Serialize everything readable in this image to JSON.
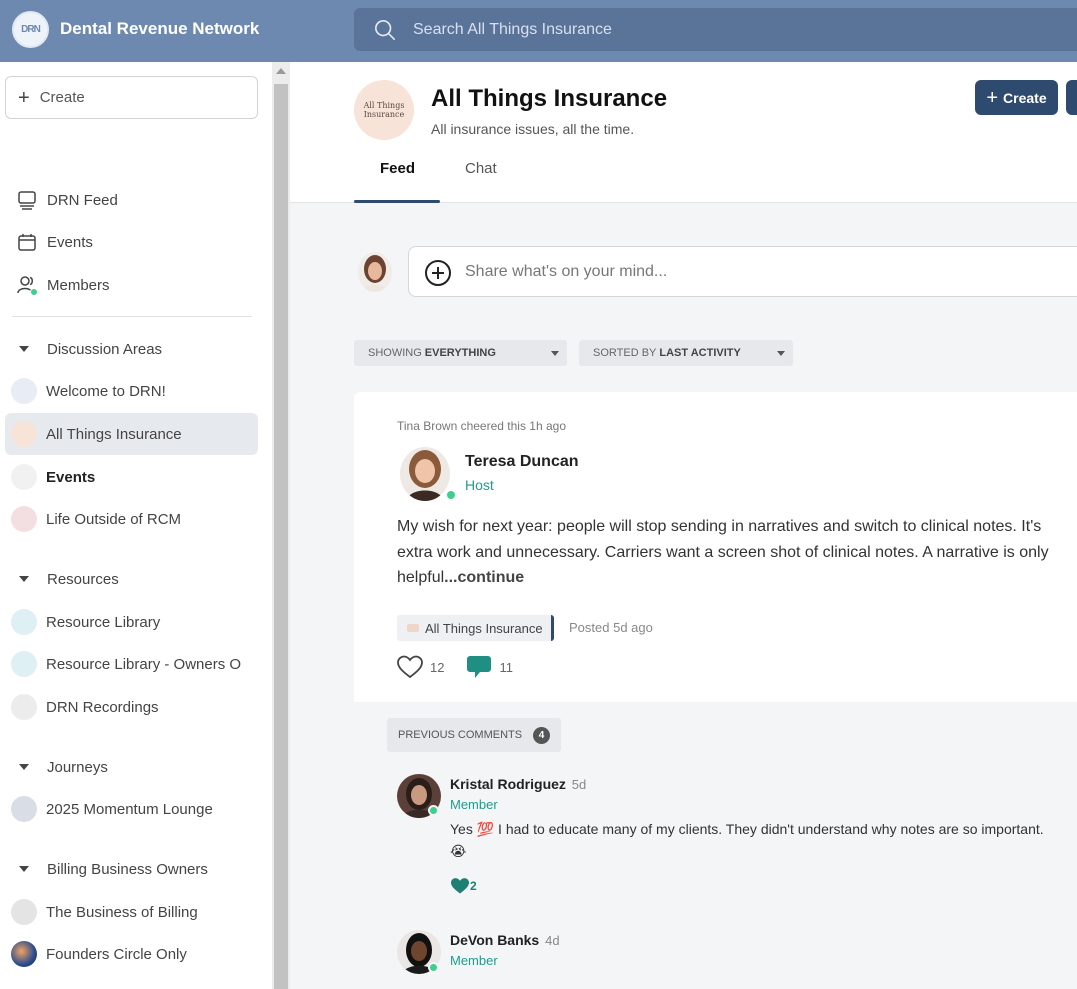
{
  "app": {
    "name": "Dental Revenue Network",
    "logo_text": "DRN"
  },
  "search": {
    "placeholder": "Search All Things Insurance"
  },
  "sidebar": {
    "create_label": "Create",
    "top_items": [
      {
        "label": "DRN Feed",
        "icon": "monitor-icon"
      },
      {
        "label": "Events",
        "icon": "calendar-icon"
      },
      {
        "label": "Members",
        "icon": "people-icon"
      }
    ],
    "sections": [
      {
        "label": "Discussion Areas",
        "items": [
          "Welcome to DRN!",
          "All Things Insurance",
          "Events",
          "Life Outside of RCM"
        ]
      },
      {
        "label": "Resources",
        "items": [
          "Resource Library",
          "Resource Library - Owners O",
          "DRN Recordings"
        ]
      },
      {
        "label": "Journeys",
        "items": [
          "2025 Momentum Lounge"
        ]
      },
      {
        "label": "Billing Business Owners",
        "items": [
          "The Business of Billing",
          "Founders Circle Only"
        ]
      }
    ],
    "active_item": "All Things Insurance"
  },
  "group": {
    "avatar_text": "All Things Insurance",
    "title": "All Things Insurance",
    "subtitle": "All insurance issues, all the time.",
    "create_label": "Create",
    "tabs": [
      "Feed",
      "Chat"
    ],
    "active_tab": "Feed"
  },
  "composer": {
    "placeholder": "Share what's on your mind..."
  },
  "filters": {
    "showing_prefix": "SHOWING",
    "showing_value": "EVERYTHING",
    "sorted_prefix": "SORTED BY",
    "sorted_value": "LAST ACTIVITY"
  },
  "post": {
    "cheer": "Tina Brown cheered this 1h ago",
    "author": "Teresa Duncan",
    "role": "Host",
    "body": "My wish for next year: people will stop sending in narratives and switch to clinical notes. It's extra work and unnecessary. Carriers want a screen shot of clinical notes. A narrative is only helpful",
    "continue": "...continue",
    "tag": "All Things Insurance",
    "posted": "Posted 5d ago",
    "likes": "12",
    "comments": "11"
  },
  "comments": {
    "previous_label": "PREVIOUS COMMENTS",
    "previous_count": "4",
    "items": [
      {
        "name": "Kristal Rodriguez",
        "time": "5d",
        "role": "Member",
        "text": "Yes 💯 I had to educate many of my clients. They didn't understand why notes are so important. 😭",
        "likes": "2"
      },
      {
        "name": "DeVon Banks",
        "time": "4d",
        "role": "Member"
      }
    ]
  },
  "colors": {
    "topbar": "#6d89b0",
    "accent": "#2e4a6e",
    "teal": "#1e9c8c",
    "online": "#3ccf8e"
  }
}
